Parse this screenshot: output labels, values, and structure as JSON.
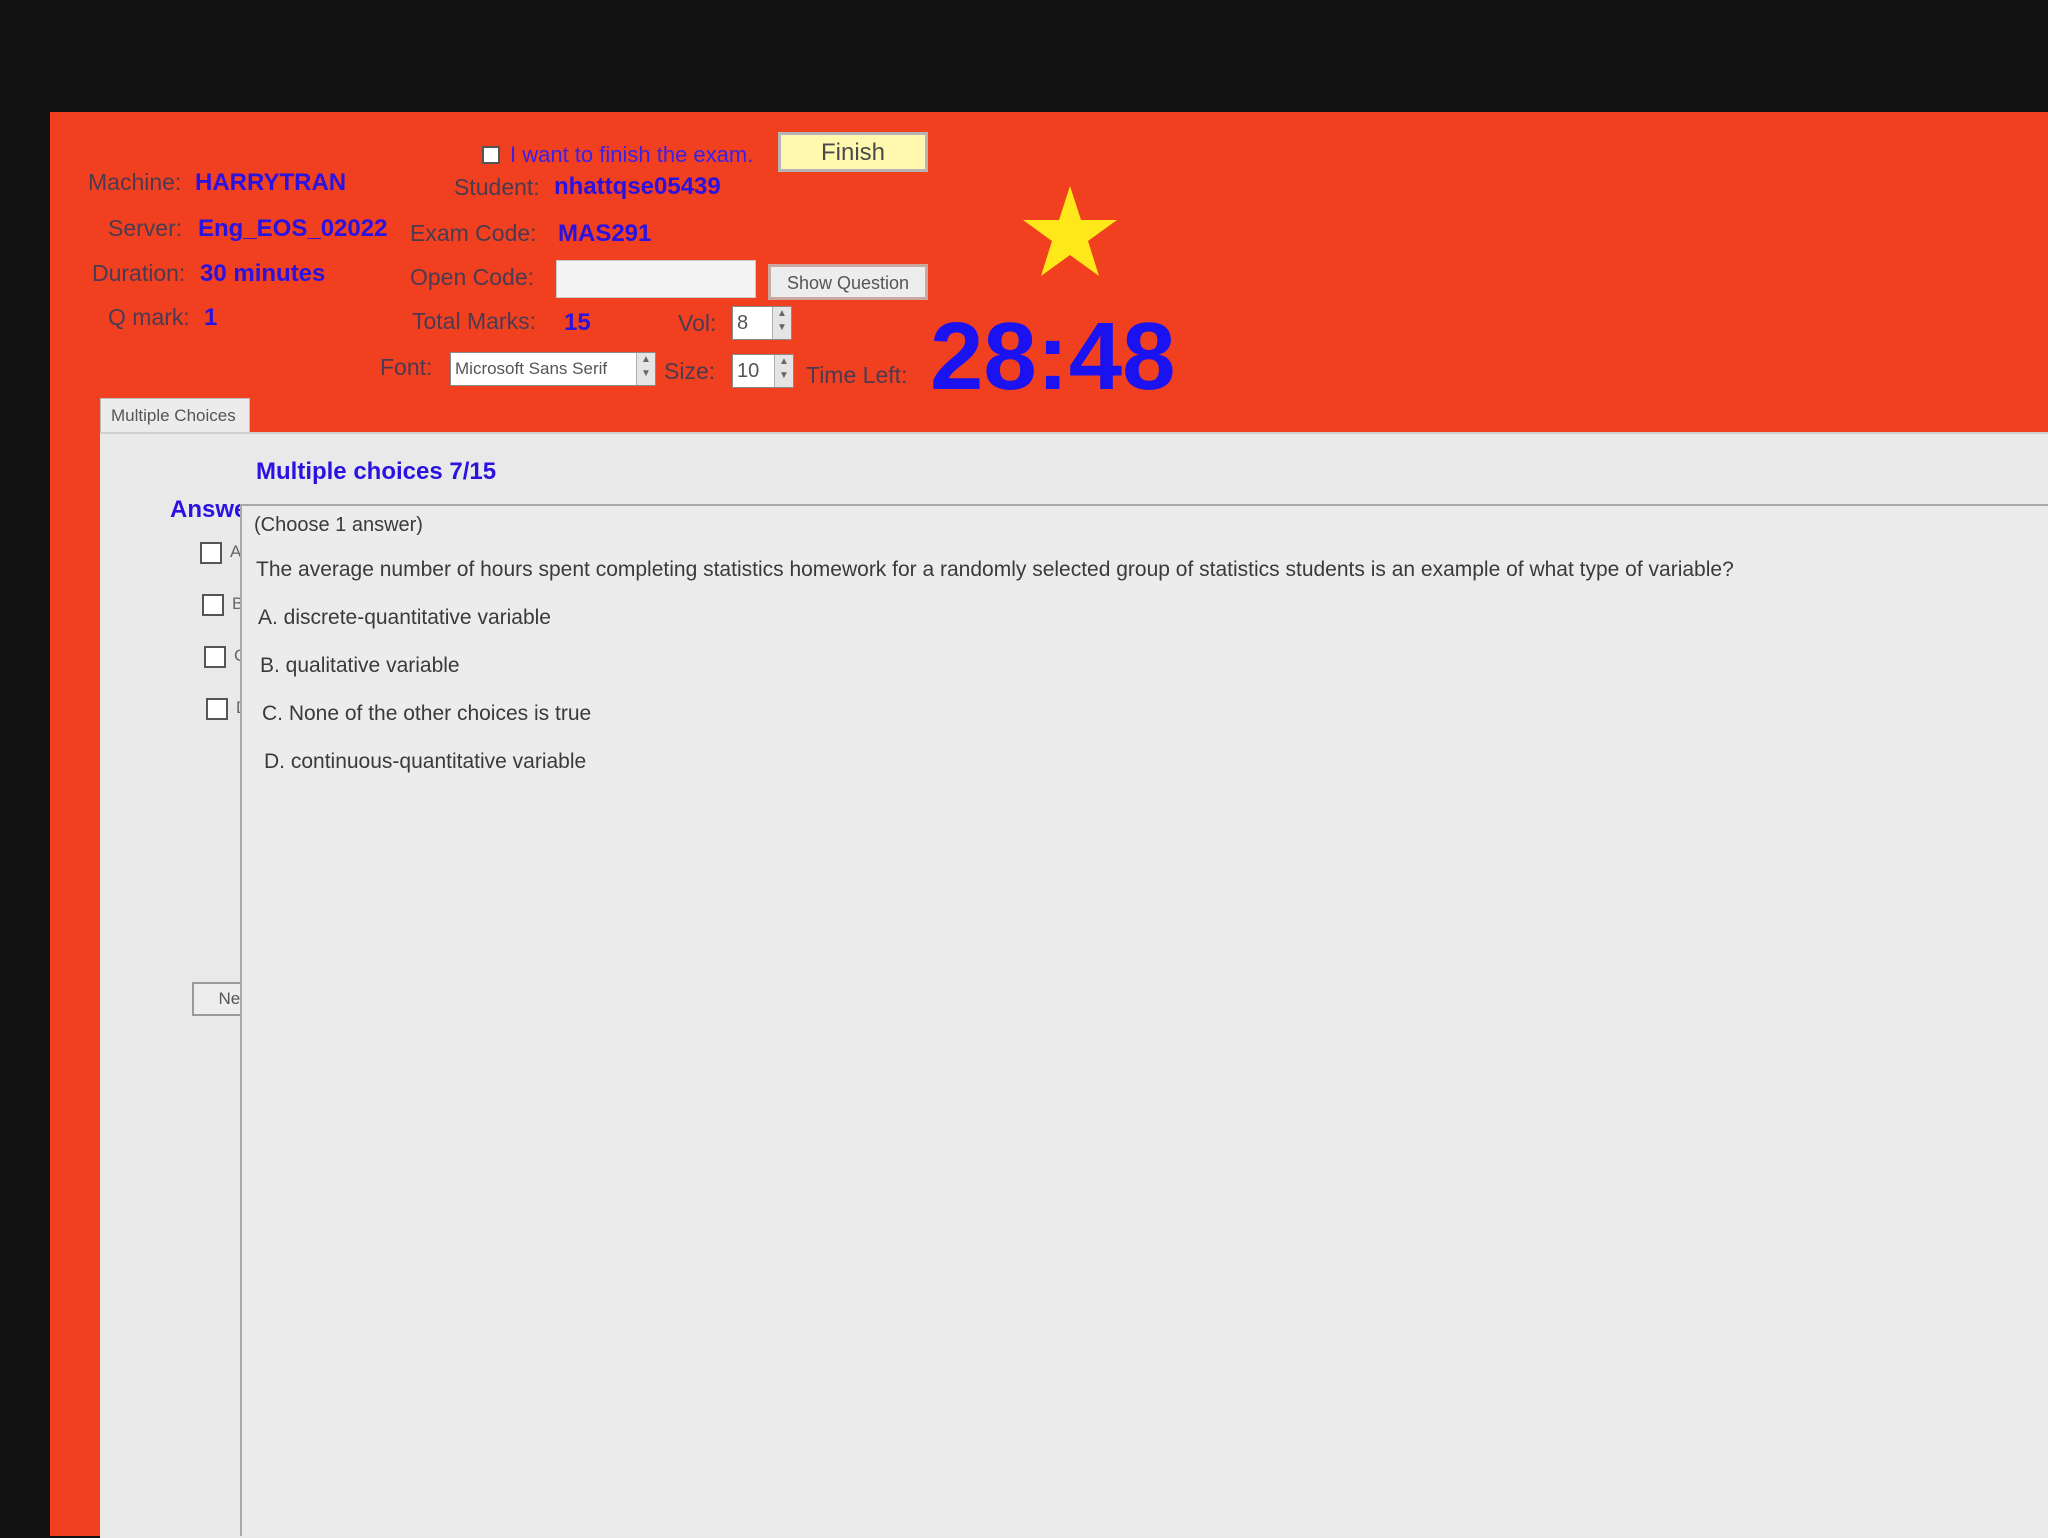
{
  "header": {
    "finish_checkbox_label": "I want to finish the exam.",
    "finish_button": "Finish",
    "machine_label": "Machine:",
    "machine_value": "HARRYTRAN",
    "student_label": "Student:",
    "student_value": "nhattqse05439",
    "server_label": "Server:",
    "server_value": "Eng_EOS_02022",
    "exam_code_label": "Exam Code:",
    "exam_code_value": "MAS291",
    "duration_label": "Duration:",
    "duration_value": "30 minutes",
    "open_code_label": "Open Code:",
    "open_code_value": "",
    "show_question_button": "Show Question",
    "qmark_label": "Q mark:",
    "qmark_value": "1",
    "total_marks_label": "Total Marks:",
    "total_marks_value": "15",
    "vol_label": "Vol:",
    "vol_value": "8",
    "font_label": "Font:",
    "font_value": "Microsoft Sans Serif",
    "size_label": "Size:",
    "size_value": "10",
    "time_left_label": "Time Left:",
    "time_left_value": "28:48"
  },
  "colors": {
    "background": "#f1401f",
    "accent_text": "#2a12e0",
    "star": "#ffe81a"
  },
  "icons": {
    "star": "star-icon"
  },
  "tabs": [
    {
      "label": "Multiple Choices"
    }
  ],
  "question": {
    "progress": "Multiple choices 7/15",
    "answer_label": "Answer",
    "instruction": "(Choose 1 answer)",
    "text": "The average number of hours spent completing statistics homework for a randomly selected group of statistics students is an example of what type of variable?",
    "options": [
      {
        "key": "A",
        "text": "A. discrete-quantitative variable"
      },
      {
        "key": "B",
        "text": "B. qualitative variable"
      },
      {
        "key": "C",
        "text": "C. None of the other choices is true"
      },
      {
        "key": "D",
        "text": "D. continuous-quantitative variable"
      }
    ],
    "next_button": "Next"
  }
}
